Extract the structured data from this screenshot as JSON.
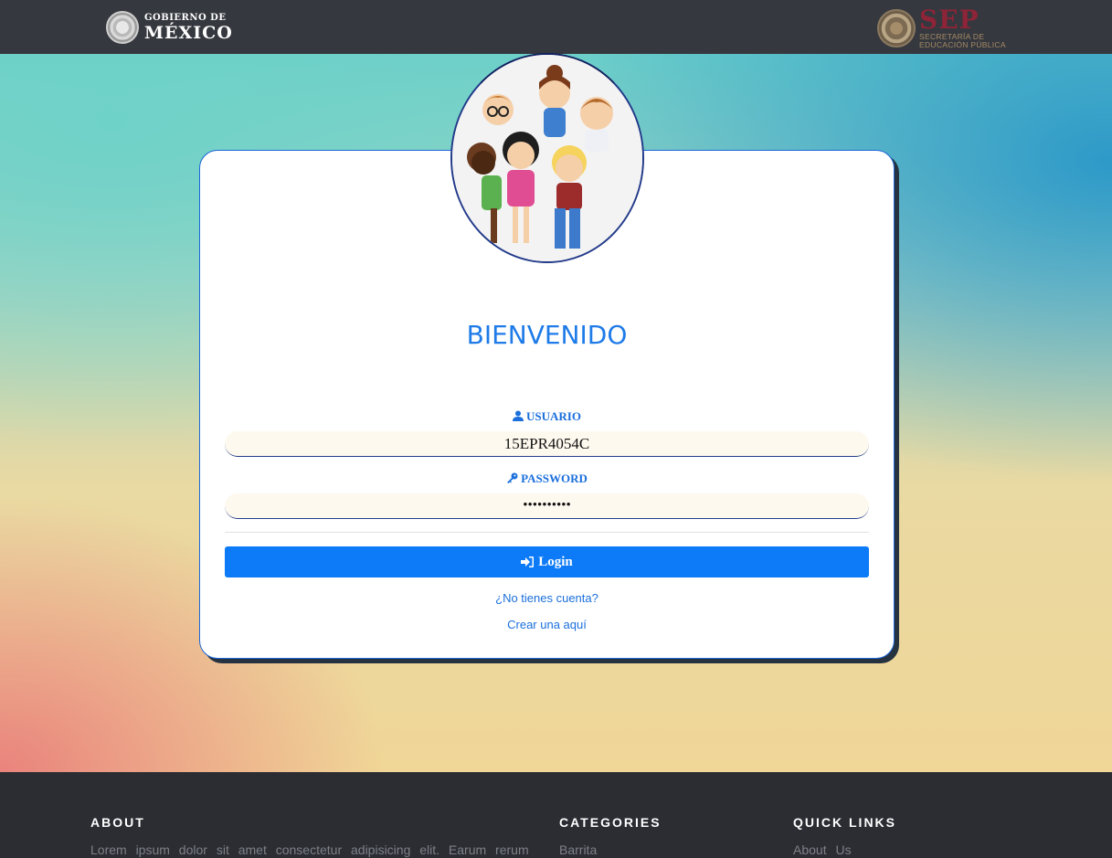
{
  "header": {
    "gob_logo": {
      "line1": "GOBIERNO DE",
      "line2": "MÉXICO"
    },
    "sep_logo": {
      "big": "SEP",
      "line1": "SECRETARÍA DE",
      "line2": "EDUCACIÓN PÚBLICA"
    }
  },
  "login": {
    "title": "BIENVENIDO",
    "user_label": "USUARIO",
    "user_value": "15EPR4054C",
    "password_label": "PASSWORD",
    "password_value": "••••••••••",
    "login_button": "Login",
    "no_account": "¿No tienes cuenta?",
    "create_link": "Crear una aquí"
  },
  "footer": {
    "about": {
      "title": "ABOUT",
      "text": "Lorem ipsum dolor sit amet consectetur adipisicing elit. Earum rerum"
    },
    "categories": {
      "title": "CATEGORIES",
      "first": "Barrita"
    },
    "quick_links": {
      "title": "QUICK LINKS",
      "first": "About Us"
    }
  },
  "colors": {
    "accent": "#1f7be8",
    "button": "#0d7bf7",
    "topbar": "#35383e",
    "footer": "#2b2d33",
    "sep_red": "#8e2438"
  }
}
